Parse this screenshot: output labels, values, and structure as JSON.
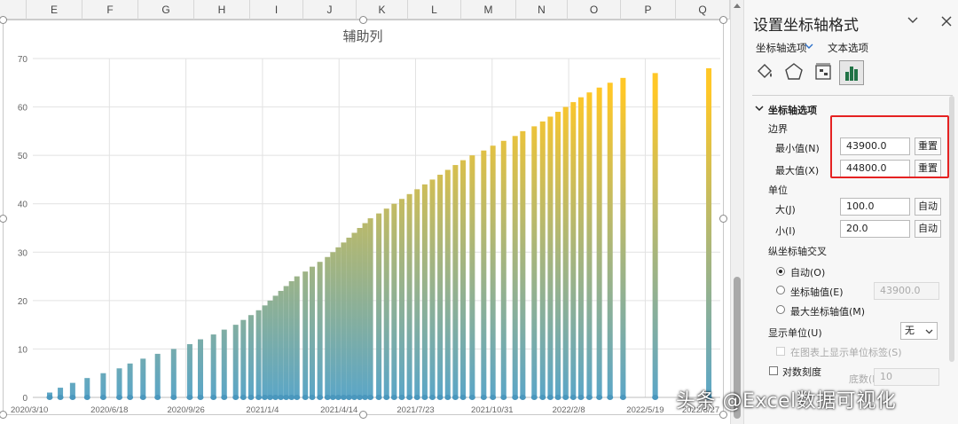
{
  "spreadsheet": {
    "columns": [
      "E",
      "F",
      "G",
      "H",
      "I",
      "J",
      "K",
      "L",
      "M",
      "N",
      "O",
      "P",
      "Q"
    ]
  },
  "chart_data": {
    "type": "bar",
    "title": "辅助列",
    "xlabel": "",
    "ylabel": "",
    "ylim": [
      0,
      70
    ],
    "yticks": [
      0,
      10,
      20,
      30,
      40,
      50,
      60,
      70
    ],
    "xlim": [
      "2020/3/10",
      "2022/8/25"
    ],
    "xtick_labels": [
      "2020/3/10",
      "2020/6/18",
      "2020/9/26",
      "2021/1/4",
      "2021/4/14",
      "2021/7/23",
      "2021/10/31",
      "2022/2/8",
      "2022/5/19",
      "2022/8/27"
    ],
    "x": [
      "2020/4/1",
      "2020/4/15",
      "2020/5/1",
      "2020/5/20",
      "2020/6/10",
      "2020/7/1",
      "2020/7/15",
      "2020/8/1",
      "2020/8/20",
      "2020/9/10",
      "2020/10/1",
      "2020/10/15",
      "2020/11/1",
      "2020/11/15",
      "2020/11/30",
      "2020/12/10",
      "2020/12/20",
      "2020/12/30",
      "2021/1/7",
      "2021/1/14",
      "2021/1/21",
      "2021/1/28",
      "2021/2/4",
      "2021/2/11",
      "2021/2/18",
      "2021/3/1",
      "2021/3/10",
      "2021/3/20",
      "2021/3/30",
      "2021/4/6",
      "2021/4/13",
      "2021/4/20",
      "2021/4/27",
      "2021/5/4",
      "2021/5/11",
      "2021/5/18",
      "2021/5/25",
      "2021/6/5",
      "2021/6/15",
      "2021/6/25",
      "2021/7/5",
      "2021/7/15",
      "2021/7/25",
      "2021/8/4",
      "2021/8/14",
      "2021/8/24",
      "2021/9/3",
      "2021/9/13",
      "2021/9/23",
      "2021/10/5",
      "2021/10/20",
      "2021/11/1",
      "2021/11/15",
      "2021/11/30",
      "2021/12/10",
      "2021/12/25",
      "2022/1/5",
      "2022/1/15",
      "2022/1/25",
      "2022/2/4",
      "2022/2/14",
      "2022/2/24",
      "2022/3/7",
      "2022/3/20",
      "2022/4/3",
      "2022/4/20",
      "2022/6/1",
      "2022/8/10"
    ],
    "values": [
      1,
      2,
      3,
      4,
      5,
      6,
      7,
      8,
      9,
      10,
      11,
      12,
      13,
      14,
      15,
      16,
      17,
      18,
      19,
      20,
      21,
      22,
      23,
      24,
      25,
      26,
      27,
      28,
      29,
      30,
      31,
      32,
      33,
      34,
      35,
      36,
      37,
      38,
      39,
      40,
      41,
      42,
      43,
      44,
      45,
      46,
      47,
      48,
      49,
      50,
      51,
      52,
      53,
      54,
      55,
      56,
      57,
      58,
      59,
      60,
      61,
      62,
      63,
      64,
      65,
      66,
      67,
      68
    ],
    "gradient": {
      "top": "#ffc727",
      "bottom": "#5ba6c7"
    },
    "marker_color": "#4a97bd"
  },
  "pane": {
    "title": "设置坐标轴格式",
    "collapse_icon": "chevron-down",
    "close_icon": "close",
    "tabs": {
      "axis_options": "坐标轴选项",
      "text_options": "文本选项"
    },
    "section_axis": "坐标轴选项",
    "bounds": {
      "label": "边界",
      "min_label": "最小值(N)",
      "min_value": "43900.0",
      "max_label": "最大值(X)",
      "max_value": "44800.0",
      "reset": "重置"
    },
    "units": {
      "label": "单位",
      "major_label": "大(J)",
      "major_value": "100.0",
      "minor_label": "小(I)",
      "minor_value": "20.0",
      "auto": "自动"
    },
    "cross": {
      "label": "纵坐标轴交叉",
      "auto": "自动(O)",
      "axis_value": "坐标轴值(E)",
      "axis_value_field": "43900.0",
      "max_axis_value": "最大坐标轴值(M)"
    },
    "display_unit": {
      "label": "显示单位(U)",
      "value": "无",
      "show_label": "在图表上显示单位标签(S)"
    },
    "log_scale": {
      "label": "对数刻度",
      "base_label": "底数(B)",
      "base_value": "10"
    }
  },
  "watermark": "头条 @Excel数据可视化"
}
